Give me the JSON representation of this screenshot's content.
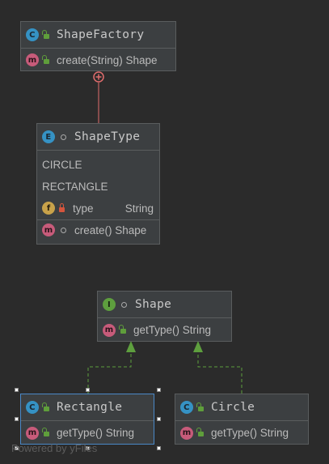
{
  "nodes": {
    "shape_factory": {
      "kind": "C",
      "title": "ShapeFactory",
      "methods": [
        {
          "kind": "m",
          "label": "create(String) Shape"
        }
      ]
    },
    "shape_type": {
      "kind": "E",
      "title": "ShapeType",
      "constants": [
        "CIRCLE",
        "RECTANGLE"
      ],
      "field": {
        "kind": "f",
        "name": "type",
        "type": "String"
      },
      "methods": [
        {
          "kind": "m",
          "label": "create() Shape"
        }
      ]
    },
    "shape": {
      "kind": "I",
      "title": "Shape",
      "methods": [
        {
          "kind": "m",
          "label": "getType() String"
        }
      ]
    },
    "rectangle": {
      "kind": "C",
      "title": "Rectangle",
      "methods": [
        {
          "kind": "m",
          "label": "getType() String"
        }
      ]
    },
    "circle": {
      "kind": "C",
      "title": "Circle",
      "methods": [
        {
          "kind": "m",
          "label": "getType() String"
        }
      ]
    }
  },
  "edges": [
    {
      "from": "shape_factory",
      "to": "shape_type",
      "relation": "inner-class"
    },
    {
      "from": "rectangle",
      "to": "shape",
      "relation": "implements"
    },
    {
      "from": "circle",
      "to": "shape",
      "relation": "implements"
    }
  ],
  "colors": {
    "background": "#2b2b2b",
    "node_fill": "#3c3f41",
    "node_border": "#5a5d5e",
    "selected_border": "#4a88c7",
    "nested_edge": "#e06c6c",
    "implements_edge": "#5e9f3e"
  },
  "watermark": "Powered by yFiles"
}
